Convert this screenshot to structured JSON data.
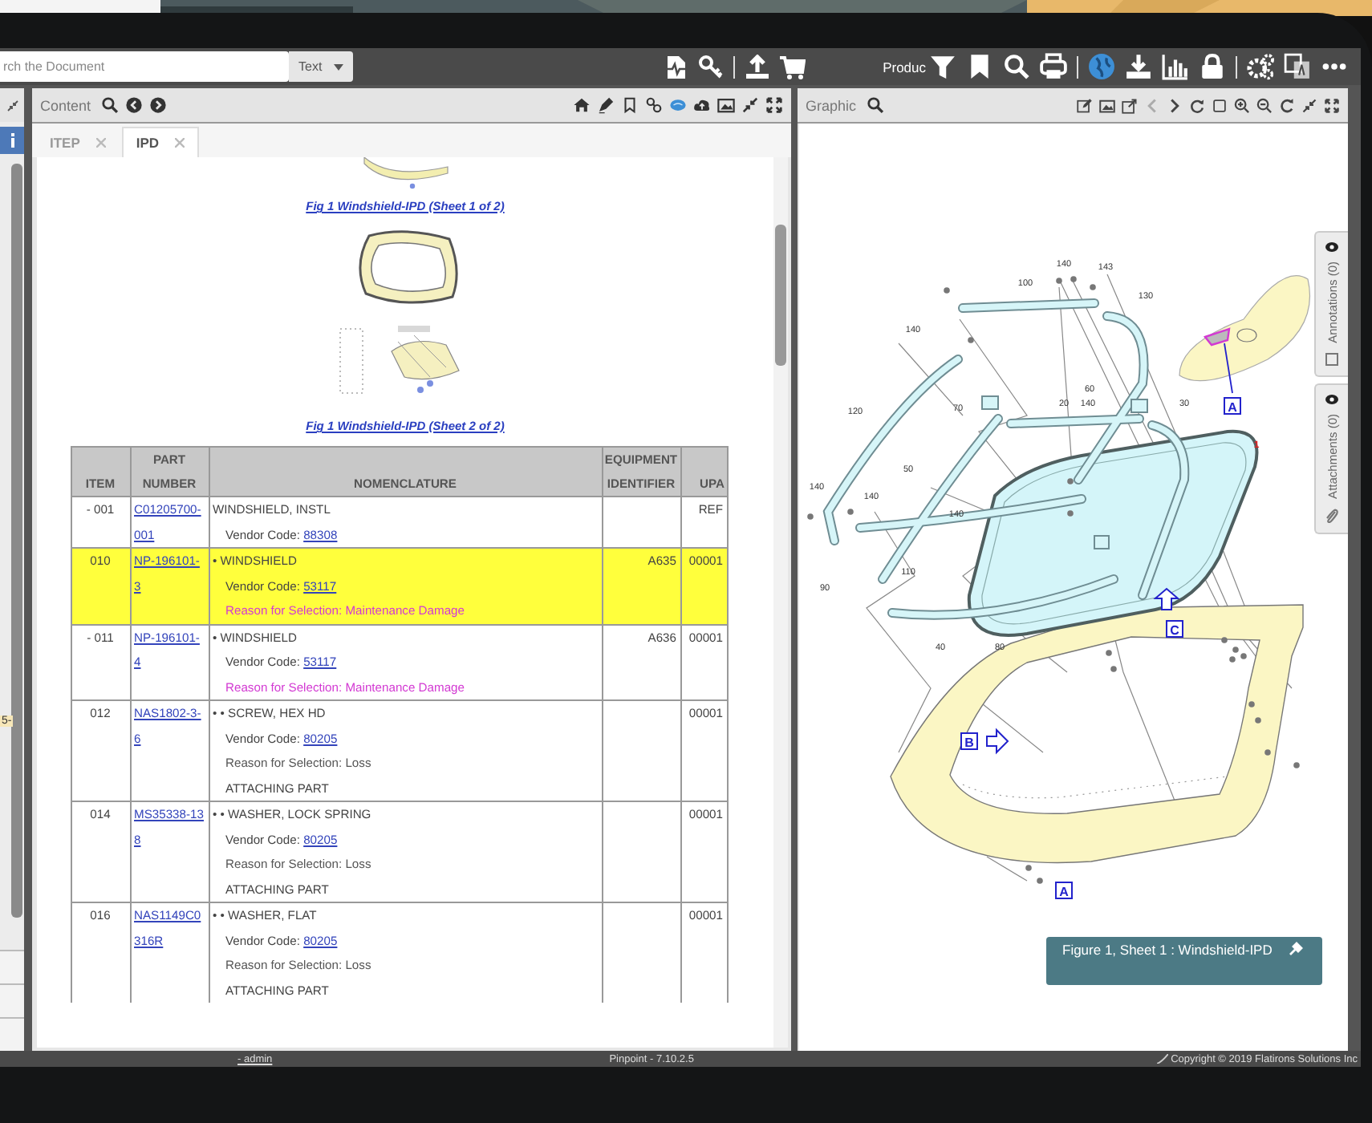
{
  "toolbar": {
    "search": {
      "placeholder": "rch the Document"
    },
    "search_mode": "Text",
    "product_filter": "Produc"
  },
  "left_panel": {
    "tag": "5-"
  },
  "content_panel": {
    "title": "Content",
    "tabs": [
      {
        "label": "ITEP",
        "selected": false
      },
      {
        "label": "IPD",
        "selected": true
      }
    ],
    "figure_captions": [
      "Fig 1  Windshield-IPD (Sheet 1 of 2)",
      "Fig 1  Windshield-IPD (Sheet 2 of 2)"
    ],
    "table": {
      "columns": [
        "ITEM",
        "PART NUMBER",
        "NOMENCLATURE",
        "EQUIPMENT IDENTIFIER",
        "UPA"
      ],
      "rows": [
        {
          "item": "- 001",
          "part_number": "C01205700-001",
          "selected": false,
          "upa": "REF",
          "lines": [
            {
              "kind": "name",
              "text": "WINDSHIELD, INSTL"
            },
            {
              "kind": "vendor",
              "label": "Vendor Code:",
              "code": "88308"
            }
          ]
        },
        {
          "item": "010",
          "part_number": "NP-196101-3",
          "selected": true,
          "equipment": "A635",
          "upa": "00001",
          "lines": [
            {
              "kind": "name",
              "text": "• WINDSHIELD"
            },
            {
              "kind": "vendor",
              "label": "Vendor Code:",
              "code": "53117"
            },
            {
              "kind": "reason",
              "flagged": true,
              "text": "Reason for Selection: Maintenance Damage"
            }
          ]
        },
        {
          "item": "- 011",
          "part_number": "NP-196101-4",
          "selected": false,
          "equipment": "A636",
          "upa": "00001",
          "lines": [
            {
              "kind": "name",
              "text": "• WINDSHIELD"
            },
            {
              "kind": "vendor",
              "label": "Vendor Code:",
              "code": "53117"
            },
            {
              "kind": "reason",
              "flagged": true,
              "text": "Reason for Selection: Maintenance Damage"
            }
          ]
        },
        {
          "item": "012",
          "part_number": "NAS1802-3-6",
          "selected": false,
          "upa": "00001",
          "lines": [
            {
              "kind": "name",
              "text": "• • SCREW, HEX HD"
            },
            {
              "kind": "vendor",
              "label": "Vendor Code:",
              "code": "80205"
            },
            {
              "kind": "reason",
              "flagged": false,
              "text": "Reason for Selection: Loss"
            },
            {
              "kind": "note",
              "text": "ATTACHING PART"
            }
          ]
        },
        {
          "item": "014",
          "part_number": "MS35338-138",
          "selected": false,
          "upa": "00001",
          "lines": [
            {
              "kind": "name",
              "text": "• • WASHER, LOCK SPRING"
            },
            {
              "kind": "vendor",
              "label": "Vendor Code:",
              "code": "80205"
            },
            {
              "kind": "reason",
              "flagged": false,
              "text": "Reason for Selection: Loss"
            },
            {
              "kind": "note",
              "text": "ATTACHING PART"
            }
          ]
        },
        {
          "item": "016",
          "part_number": "NAS1149C0316R",
          "selected": false,
          "upa": "00001",
          "lines": [
            {
              "kind": "name",
              "text": "• • WASHER, FLAT"
            },
            {
              "kind": "vendor",
              "label": "Vendor Code:",
              "code": "80205"
            },
            {
              "kind": "reason",
              "flagged": false,
              "text": "Reason for Selection: Loss"
            },
            {
              "kind": "note",
              "text": "ATTACHING PART"
            }
          ]
        }
      ]
    }
  },
  "graphic_panel": {
    "title": "Graphic",
    "previous_disabled": true,
    "callouts": [
      "140",
      "143",
      "100",
      "130",
      "140",
      "120",
      "70",
      "60",
      "20",
      "140",
      "30",
      "50",
      "140",
      "140",
      "140",
      "110",
      "90",
      "40",
      "80"
    ],
    "find_number": "1",
    "markers": [
      "A",
      "C",
      "B",
      "A"
    ],
    "caption": "Figure 1, Sheet 1 : Windshield-IPD",
    "side_tabs": [
      "Annotations (0)",
      "Attachments (0)"
    ]
  },
  "status_bar": {
    "user": "- admin",
    "version": "Pinpoint - 7.10.2.5",
    "copyright": "Copyright © 2019 Flatirons Solutions Inc"
  }
}
